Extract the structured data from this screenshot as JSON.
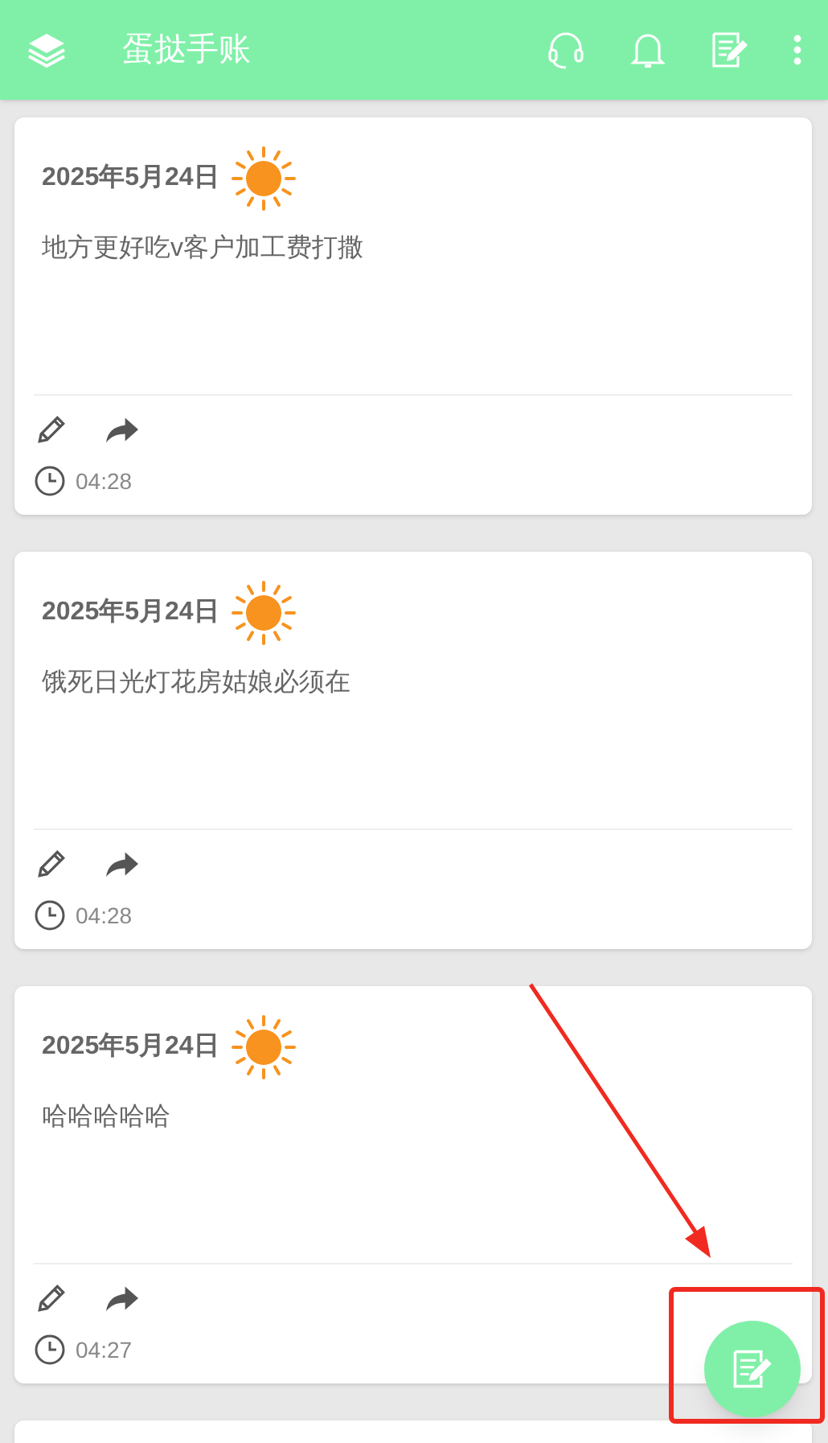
{
  "app_bar": {
    "title": "蛋挞手账"
  },
  "entries": [
    {
      "kind": "entry",
      "date": "2025年5月24日",
      "text": "地方更好吃v客户加工费打撒",
      "time": "04:28"
    },
    {
      "kind": "entry",
      "date": "2025年5月24日",
      "text": "饿死日光灯花房姑娘必须在",
      "time": "04:28"
    },
    {
      "kind": "entry",
      "date": "2025年5月24日",
      "text": "哈哈哈哈哈",
      "time": "04:27"
    },
    {
      "kind": "partial"
    }
  ],
  "annotation": {
    "kind": "arrow_and_box"
  }
}
